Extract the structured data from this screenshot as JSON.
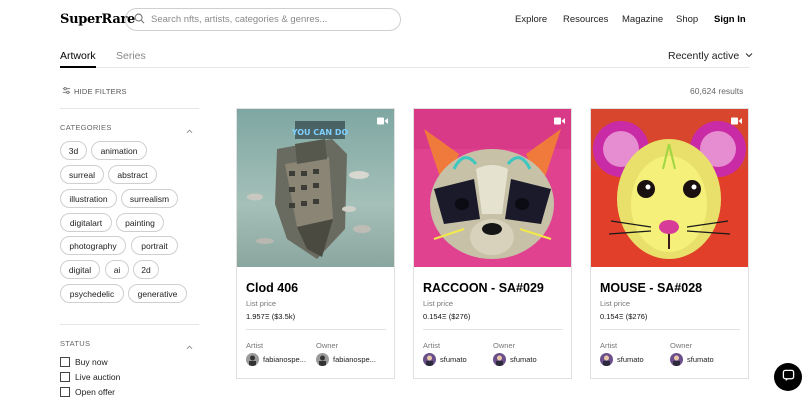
{
  "brand": {
    "logo_text": "SuperRare"
  },
  "search": {
    "placeholder": "Search nfts, artists, categories & genres..."
  },
  "nav": {
    "items": [
      "Explore",
      "Resources",
      "Magazine",
      "Shop"
    ],
    "sign_in": "Sign In"
  },
  "tabs": [
    {
      "label": "Artwork",
      "active": true
    },
    {
      "label": "Series",
      "active": false
    }
  ],
  "sort": {
    "label": "Recently active"
  },
  "filters": {
    "hide_label": "HIDE FILTERS",
    "results": "60,624 results",
    "categories_title": "CATEGORIES",
    "categories": [
      "3d",
      "animation",
      "surreal",
      "abstract",
      "illustration",
      "surrealism",
      "digitalart",
      "painting",
      "photography",
      "portrait",
      "digital",
      "ai",
      "2d",
      "psychedelic",
      "generative"
    ],
    "status_title": "STATUS",
    "status_options": [
      "Buy now",
      "Live auction",
      "Open offer"
    ]
  },
  "cards": [
    {
      "title": "Clod 406",
      "list_label": "List price",
      "price": "1.957Ξ ($3.5k)",
      "artist_label": "Artist",
      "owner_label": "Owner",
      "artist": "fabianospe...",
      "owner": "fabianospe...",
      "art_text": "YOU CAN DO"
    },
    {
      "title": "RACCOON - SA#029",
      "list_label": "List price",
      "price": "0.154Ξ ($276)",
      "artist_label": "Artist",
      "owner_label": "Owner",
      "artist": "sfumato",
      "owner": "sfumato"
    },
    {
      "title": "MOUSE - SA#028",
      "list_label": "List price",
      "price": "0.154Ξ ($276)",
      "artist_label": "Artist",
      "owner_label": "Owner",
      "artist": "sfumato",
      "owner": "sfumato"
    }
  ],
  "icons": {
    "search": "search-icon",
    "sort_chevron": "chevron-down-icon",
    "filters": "sliders-icon",
    "collapse": "chevron-up-icon",
    "video": "video-icon",
    "chat": "chat-icon"
  },
  "colors": {
    "accent": "#000000",
    "border": "#e0e0e0",
    "muted_text": "#777777"
  }
}
